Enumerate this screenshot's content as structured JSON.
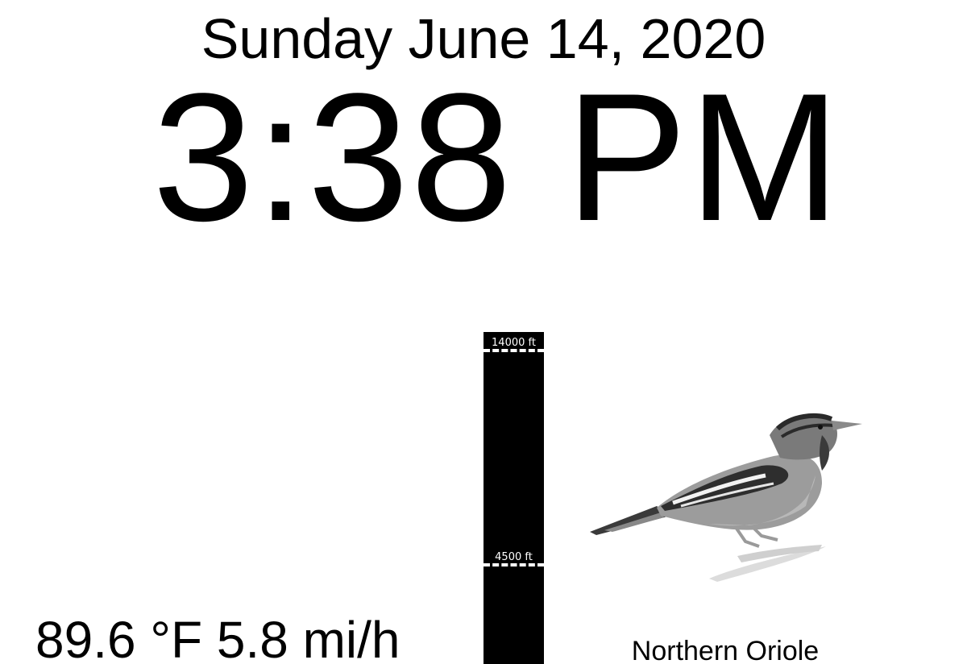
{
  "date_text": "Sunday June 14, 2020",
  "time_text": "3:38 PM",
  "weather": {
    "text": "89.6 °F 5.8 mi/h"
  },
  "altitude": {
    "ticks": [
      {
        "label": "14000 ft"
      },
      {
        "label": "4500 ft"
      }
    ]
  },
  "bird": {
    "name": "Northern Oriole",
    "image_icon": "oriole-bird-illustration"
  }
}
